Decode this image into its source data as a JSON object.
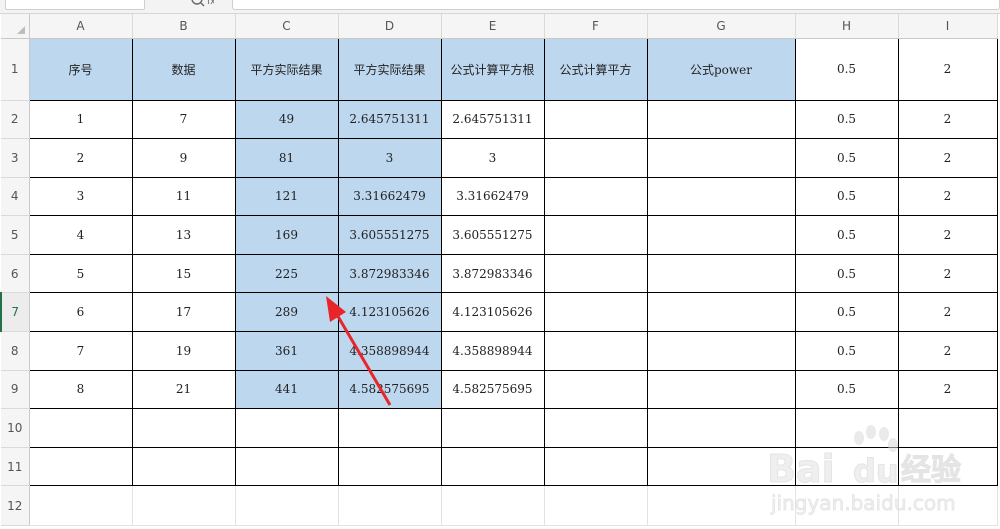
{
  "columns": [
    "A",
    "B",
    "C",
    "D",
    "E",
    "F",
    "G",
    "H",
    "I"
  ],
  "rows": [
    {
      "num": "1",
      "cells": [
        "序号",
        "数据",
        "平方实际结果",
        "平方实际结果",
        "公式计算平方根",
        "公式计算平方",
        "公式power",
        "0.5",
        "2"
      ]
    },
    {
      "num": "2",
      "cells": [
        "1",
        "7",
        "49",
        "2.645751311",
        "2.645751311",
        "",
        "",
        "0.5",
        "2"
      ]
    },
    {
      "num": "3",
      "cells": [
        "2",
        "9",
        "81",
        "3",
        "3",
        "",
        "",
        "0.5",
        "2"
      ]
    },
    {
      "num": "4",
      "cells": [
        "3",
        "11",
        "121",
        "3.31662479",
        "3.31662479",
        "",
        "",
        "0.5",
        "2"
      ]
    },
    {
      "num": "5",
      "cells": [
        "4",
        "13",
        "169",
        "3.605551275",
        "3.605551275",
        "",
        "",
        "0.5",
        "2"
      ]
    },
    {
      "num": "6",
      "cells": [
        "5",
        "15",
        "225",
        "3.872983346",
        "3.872983346",
        "",
        "",
        "0.5",
        "2"
      ]
    },
    {
      "num": "7",
      "cells": [
        "6",
        "17",
        "289",
        "4.123105626",
        "4.123105626",
        "",
        "",
        "0.5",
        "2"
      ]
    },
    {
      "num": "8",
      "cells": [
        "7",
        "19",
        "361",
        "4.358898944",
        "4.358898944",
        "",
        "",
        "0.5",
        "2"
      ]
    },
    {
      "num": "9",
      "cells": [
        "8",
        "21",
        "441",
        "4.582575695",
        "4.582575695",
        "",
        "",
        "0.5",
        "2"
      ]
    },
    {
      "num": "10",
      "cells": [
        "",
        "",
        "",
        "",
        "",
        "",
        "",
        "",
        ""
      ]
    },
    {
      "num": "11",
      "cells": [
        "",
        "",
        "",
        "",
        "",
        "",
        "",
        "",
        ""
      ]
    },
    {
      "num": "12",
      "cells": [
        "",
        "",
        "",
        "",
        "",
        "",
        "",
        "",
        ""
      ]
    }
  ],
  "active_row": "7",
  "icons": {
    "corner": "select-all-triangle-icon",
    "zoom": "zoom-icon",
    "annotation": "red-arrow-icon",
    "watermark": "baidu-jingyan-watermark"
  },
  "watermark": {
    "line1": "Bai",
    "line1b": "du",
    "line1c": "经验",
    "line2": "jingyan.baidu.com"
  },
  "colors": {
    "header_fill": "#bdd7ee",
    "arrow": "#e8262a",
    "active_row": "#217346"
  }
}
